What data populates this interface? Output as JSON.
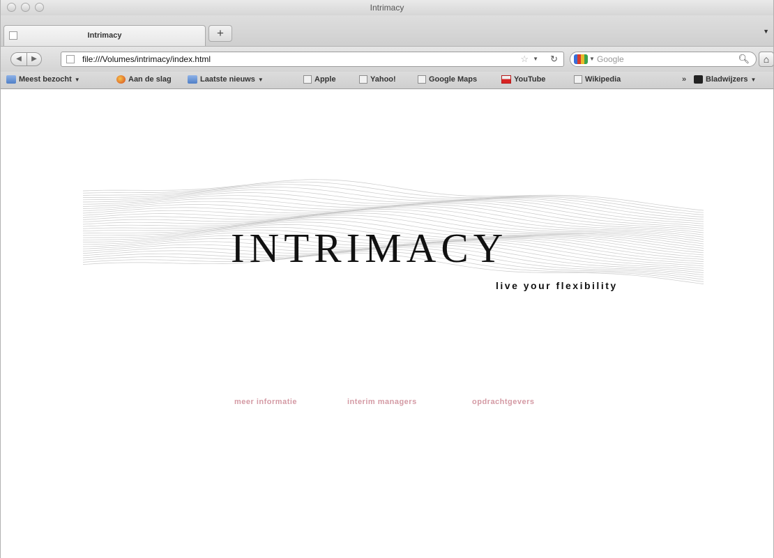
{
  "window": {
    "title": "Intrimacy"
  },
  "tabs": [
    {
      "label": "Intrimacy"
    }
  ],
  "tabstrip": {
    "new_tab_label": "+"
  },
  "nav": {
    "url": "file:///Volumes/intrimacy/index.html",
    "search_placeholder": "Google",
    "icons": [
      "back-arrow-icon",
      "forward-arrow-icon",
      "bookmark-star-icon",
      "reload-icon",
      "search-icon",
      "home-icon"
    ]
  },
  "bookmarks": {
    "items": [
      {
        "label": "Meest bezocht",
        "icon": "folder-icon",
        "has_menu": true
      },
      {
        "label": "Aan de slag",
        "icon": "firefox-icon",
        "has_menu": false
      },
      {
        "label": "Laatste nieuws",
        "icon": "folder-icon",
        "has_menu": true
      },
      {
        "label": "Apple",
        "icon": "page-icon",
        "has_menu": false
      },
      {
        "label": "Yahoo!",
        "icon": "page-icon",
        "has_menu": false
      },
      {
        "label": "Google Maps",
        "icon": "page-icon",
        "has_menu": false
      },
      {
        "label": "YouTube",
        "icon": "youtube-icon",
        "has_menu": false
      },
      {
        "label": "Wikipedia",
        "icon": "page-icon",
        "has_menu": false
      }
    ],
    "overflow": "»",
    "bladwijzers": "Bladwijzers"
  },
  "page": {
    "logo": "INTRIMACY",
    "tagline": "live your flexibility",
    "links": [
      "meer informatie",
      "interim managers",
      "opdrachtgevers"
    ],
    "link_color": "#d49aa4"
  }
}
